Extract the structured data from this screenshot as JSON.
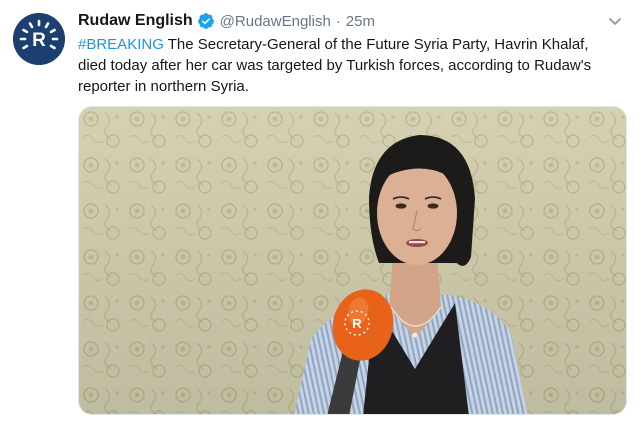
{
  "tweet": {
    "author_name": "Rudaw English",
    "handle": "@RudawEnglish",
    "separator": "·",
    "time": "25m",
    "hashtag": "#BREAKING",
    "body": " The Secretary-General of the Future Syria Party, Havrin Khalaf, died today after her car was targeted by Turkish forces, according to Rudaw's reporter in northern Syria."
  },
  "icons": {
    "avatar": "rudaw-logo",
    "verified": "verified-badge-icon",
    "caret": "chevron-down-icon",
    "mic_flag": "rudaw-logo"
  },
  "colors": {
    "accent": "#1b95e0",
    "secondary_text": "#657786",
    "avatar_bg": "#1b3f6f",
    "mic_flag": "#e8621a"
  }
}
